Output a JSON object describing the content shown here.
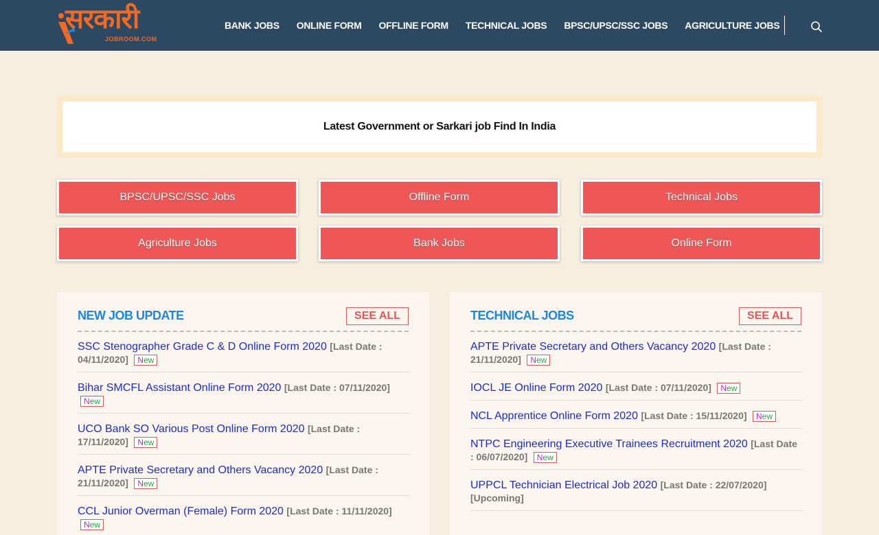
{
  "header": {
    "logo_text": "सरकारी",
    "logo_sub": "JOBROOM.COM",
    "nav": [
      "BANK JOBS",
      "ONLINE FORM",
      "OFFLINE FORM",
      "TECHNICAL JOBS",
      "BPSC/UPSC/SSC JOBS",
      "AGRICULTURE JOBS"
    ]
  },
  "banner": {
    "title": "Latest Government or Sarkari job Find In India"
  },
  "categories": [
    "BPSC/UPSC/SSC Jobs",
    "Offline Form",
    "Technical Jobs",
    "Agriculture Jobs",
    "Bank Jobs",
    "Online Form"
  ],
  "panels": [
    {
      "title": "NEW JOB UPDATE",
      "see_all": "SEE ALL",
      "items": [
        {
          "title": "SSC Stenographer Grade C & D Online Form 2020",
          "date": "[Last Date : 04/11/2020]",
          "badge": "New"
        },
        {
          "title": "Bihar SMCFL Assistant Online Form 2020",
          "date": "[Last Date : 07/11/2020]",
          "badge": "New"
        },
        {
          "title": "UCO Bank SO Various Post Online Form 2020",
          "date": "[Last Date : 17/11/2020]",
          "badge": "New"
        },
        {
          "title": "APTE Private Secretary and Others Vacancy 2020",
          "date": "[Last Date : 21/11/2020]",
          "badge": "New"
        },
        {
          "title": "CCL Junior Overman (Female) Form 2020",
          "date": "[Last Date : 11/11/2020]",
          "badge": "New"
        }
      ]
    },
    {
      "title": "TECHNICAL JOBS",
      "see_all": "SEE ALL",
      "items": [
        {
          "title": "APTE Private Secretary and Others Vacancy 2020",
          "date": "[Last Date : 21/11/2020]",
          "badge": "New"
        },
        {
          "title": "IOCL JE Online Form 2020",
          "date": "[Last Date : 07/11/2020]",
          "badge": "New"
        },
        {
          "title": "NCL Apprentice Online Form 2020",
          "date": "[Last Date : 15/11/2020]",
          "badge": "New"
        },
        {
          "title": "NTPC Engineering Executive Trainees Recruitment 2020",
          "date": "[Last Date : 06/07/2020]",
          "badge": "New"
        },
        {
          "title": "UPPCL Technician Electrical Job 2020",
          "date": "[Last Date : 22/07/2020] [Upcoming]",
          "badge": ""
        }
      ]
    }
  ],
  "colors": {
    "header_bg": "#2d4961",
    "accent": "#ef5656",
    "link": "#1a2ad6",
    "title_blue": "#1a86e8",
    "logo": "#ef6a24"
  }
}
